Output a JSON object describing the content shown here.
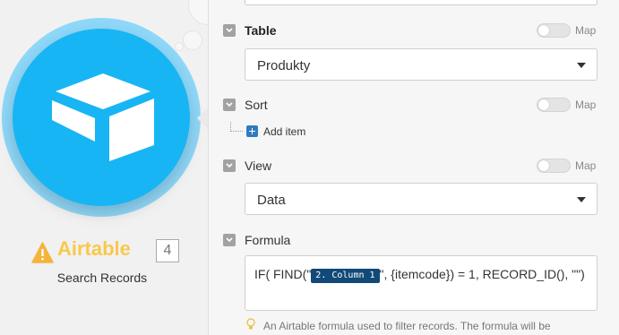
{
  "module": {
    "app_name": "Airtable",
    "badge": "4",
    "label": "Search Records",
    "colors": {
      "brand": "#18b5f4",
      "halo": "#8fd8f9",
      "app_name": "#f9c84c"
    }
  },
  "panel": {
    "map_label": "Map",
    "table": {
      "label": "Table",
      "value": "Produkty"
    },
    "sort": {
      "label": "Sort",
      "add_item": "Add item"
    },
    "view": {
      "label": "View",
      "value": "Data"
    },
    "formula": {
      "label": "Formula",
      "text_before": "IF(  FIND(\"",
      "pill": "2. Column 1",
      "text_after": "\", {itemcode}) = 1,  RECORD_ID(),  \"\")",
      "hint": "An Airtable formula used to filter records. The formula will be"
    }
  }
}
